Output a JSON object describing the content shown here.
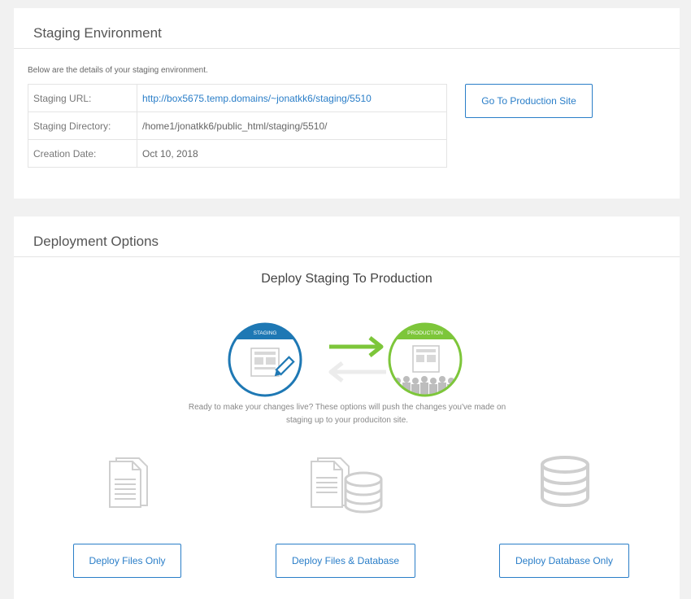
{
  "staging": {
    "title": "Staging Environment",
    "intro": "Below are the details of your staging environment.",
    "rows": [
      {
        "label": "Staging URL:",
        "value": "http://box5675.temp.domains/~jonatkk6/staging/5510"
      },
      {
        "label": "Staging Directory:",
        "value": "/home1/jonatkk6/public_html/staging/5510/"
      },
      {
        "label": "Creation Date:",
        "value": "Oct 10, 2018"
      }
    ],
    "go_production_label": "Go To Production Site"
  },
  "deployment": {
    "title": "Deployment Options",
    "heading": "Deploy Staging To Production",
    "illustration": {
      "staging_label": "STAGING",
      "production_label": "PRODUCTION"
    },
    "description_line1": "Ready to make your changes live? These options will push the changes you've made on",
    "description_line2": "staging up to your produciton site.",
    "options": [
      {
        "icon": "files-icon",
        "label": "Deploy Files Only"
      },
      {
        "icon": "files-database-icon",
        "label": "Deploy Files & Database"
      },
      {
        "icon": "database-icon",
        "label": "Deploy Database Only"
      }
    ]
  },
  "colors": {
    "accent": "#2a7ec8",
    "staging_blue": "#1e78b4",
    "production_green": "#7dc63a",
    "icon_gray": "#cfcfcf"
  }
}
